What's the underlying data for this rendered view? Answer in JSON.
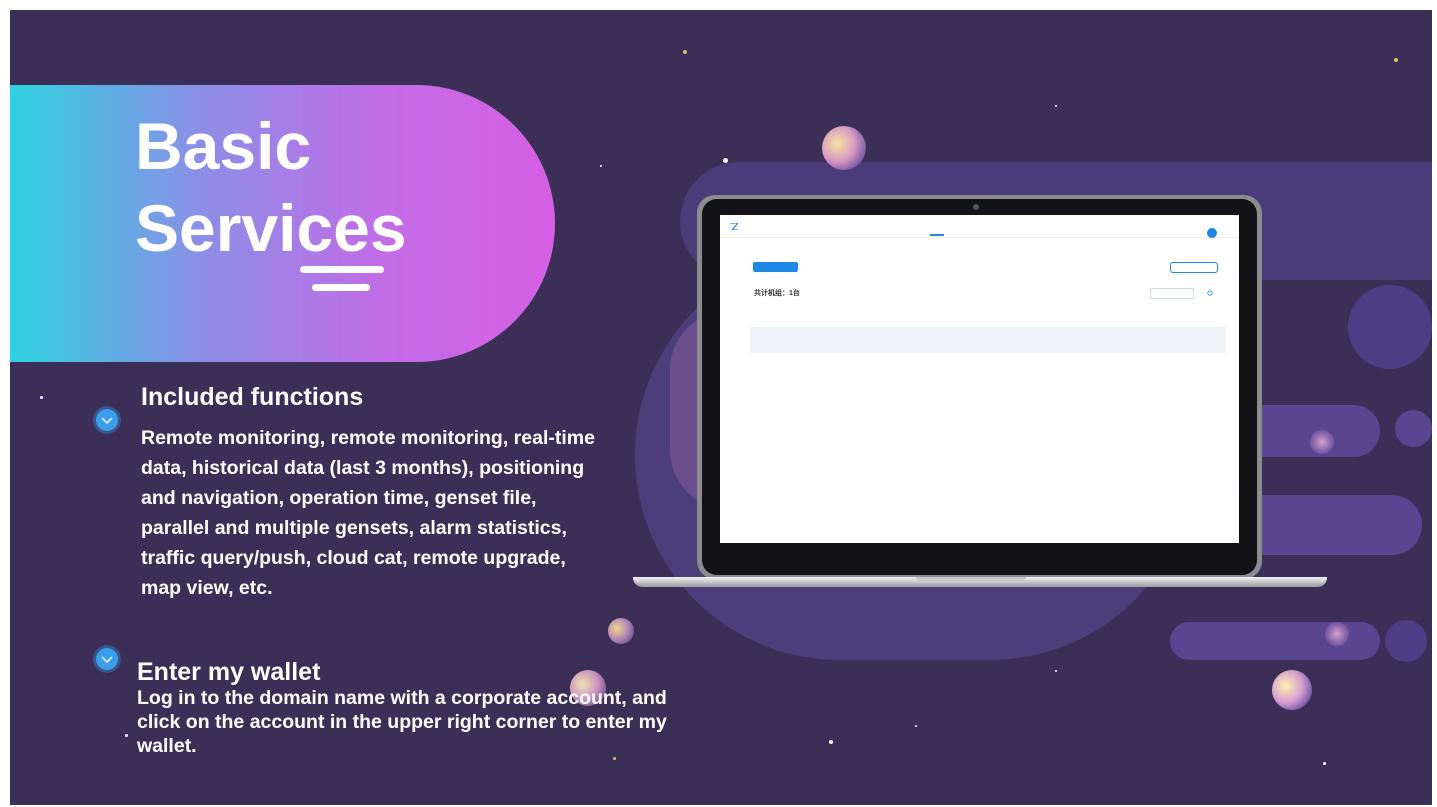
{
  "slide": {
    "title_line1": "Basic",
    "title_line2": "Services",
    "sections": [
      {
        "heading": "Included functions",
        "body": "Remote monitoring, remote monitoring, real-time data, historical data (last 3 months), positioning and navigation, operation time, genset file, parallel and multiple gensets, alarm statistics, traffic query/push, cloud cat, remote upgrade, map view, etc."
      },
      {
        "heading": "Enter my wallet",
        "body": "Log in to the domain name with a corporate account, and click on the account in the upper right corner to enter my wallet."
      }
    ]
  },
  "icons": {
    "bullet": "check-circle-icon",
    "app_logo": "app-logo-icon",
    "refresh": "refresh-icon",
    "user_avatar": "user-avatar-icon"
  },
  "colors": {
    "background": "#3b2f58",
    "title_gradient_start": "#2ed2e0",
    "title_gradient_end": "#d65fe4",
    "bullet": "#3a9eea",
    "app_accent": "#1e88e5"
  },
  "app": {
    "logo_text": "",
    "nav_items": [
      "",
      "",
      "",
      "",
      "",
      "",
      ""
    ],
    "active_nav_index": 1,
    "user_name": "",
    "primary_button": "",
    "outline_button": "",
    "count_label": "共计机组：1台",
    "filters": [
      "",
      "",
      ""
    ],
    "table_headers": [
      "",
      "",
      "",
      "",
      ""
    ],
    "table_rows": [
      [
        "",
        "",
        "",
        "",
        ""
      ]
    ],
    "footer_text": ""
  }
}
